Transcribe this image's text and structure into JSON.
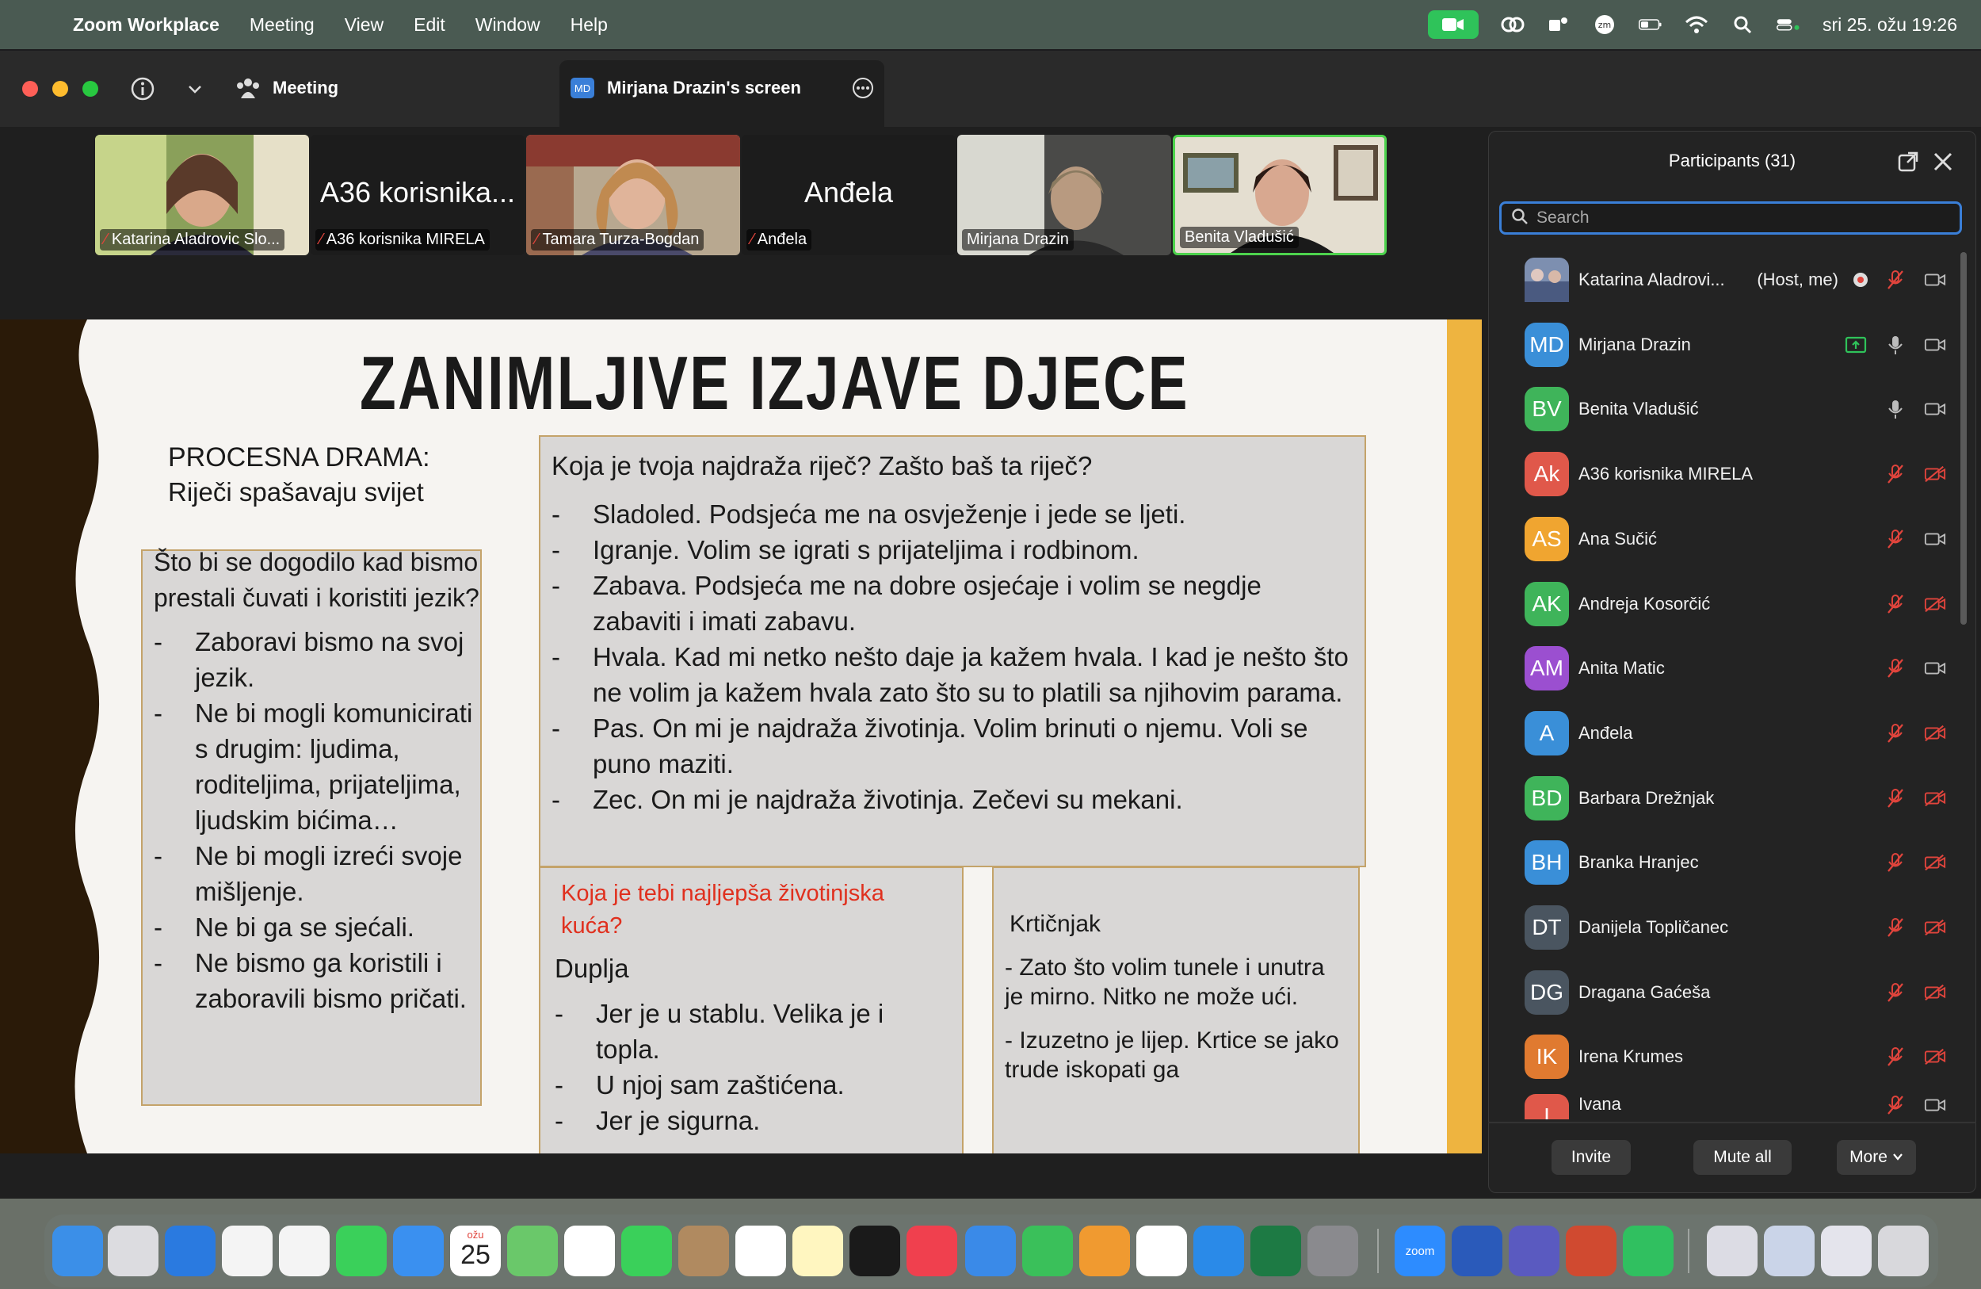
{
  "menubar": {
    "app": "Zoom Workplace",
    "items": [
      "Meeting",
      "View",
      "Edit",
      "Window",
      "Help"
    ],
    "datetime": "sri 25. ožu 19:26"
  },
  "titlebar": {
    "meeting_label": "Meeting",
    "share_badge": "MD",
    "share_tab": "Mirjana Drazin's screen"
  },
  "thumbnails": [
    {
      "name": "Katarina Aladrovic Slo...",
      "muted": true,
      "big": ""
    },
    {
      "name": "A36 korisnika MIRELA",
      "muted": true,
      "big": "A36 korisnika..."
    },
    {
      "name": "Tamara Turza-Bogdan",
      "muted": true,
      "big": ""
    },
    {
      "name": "Anđela",
      "muted": true,
      "big": "Anđela"
    },
    {
      "name": "Mirjana Drazin",
      "muted": false,
      "big": ""
    },
    {
      "name": "Benita Vladušić",
      "muted": false,
      "big": ""
    }
  ],
  "slide": {
    "title": "ZANIMLJIVE IZJAVE DJECE",
    "subtitle1": "PROCESNA DRAMA:",
    "subtitle2": "Riječi spašavaju svijet",
    "left_question": "Što bi se dogodilo kad bismo prestali čuvati i koristiti jezik?",
    "left_items": [
      "Zaboravi bismo na svoj jezik.",
      "Ne bi mogli komunicirati s drugim: ljudima, roditeljima, prijateljima, ljudskim bićima…",
      "Ne bi mogli izreći svoje mišljenje.",
      "Ne bi ga se sjećali.",
      "Ne bismo ga koristili i zaboravili bismo pričati."
    ],
    "main_question": "Koja je tvoja najdraža riječ? Zašto baš ta riječ?",
    "main_items": [
      "Sladoled. Podsjeća me na osvježenje i jede se ljeti.",
      "Igranje. Volim se igrati s prijateljima i rodbinom.",
      "Zabava. Podsjeća me na dobre osjećaje i volim se negdje zabaviti i imati zabavu.",
      "Hvala. Kad mi netko nešto daje ja kažem hvala. I kad je nešto što ne volim ja kažem hvala zato što su to platili sa njihovim parama.",
      "Pas. On mi je najdraža životinja. Volim brinuti o njemu. Voli se puno maziti.",
      "Zec. On mi je najdraža životinja. Zečevi su mekani."
    ],
    "house_question": "Koja je tebi najljepša životinjska kuća?",
    "house_answer": "Duplja",
    "house_items": [
      "Jer je u stablu. Velika je i topla.",
      "U njoj sam zaštićena.",
      "Jer je sigurna."
    ],
    "mole_title": "Krtičnjak",
    "mole_p1": "- Zato što volim tunele i unutra je mirno. Nitko ne može ući.",
    "mole_p2": "- Izuzetno je lijep. Krtice se jako trude iskopati ga"
  },
  "panel": {
    "title": "Participants (31)",
    "search_placeholder": "Search",
    "participants": [
      {
        "initials": "",
        "name": "Katarina Aladrovi...",
        "tag": "(Host, me)",
        "color": "#6b7fa3",
        "mic": "muted",
        "video": "on"
      },
      {
        "initials": "MD",
        "name": "Mirjana Drazin",
        "tag": "",
        "color": "#3a8fd8",
        "mic": "on",
        "video": "on"
      },
      {
        "initials": "BV",
        "name": "Benita Vladušić",
        "tag": "",
        "color": "#3fb45a",
        "mic": "on",
        "video": "on"
      },
      {
        "initials": "Ak",
        "name": "A36 korisnika MIRELA",
        "tag": "",
        "color": "#e0584a",
        "mic": "muted",
        "video": "off"
      },
      {
        "initials": "AS",
        "name": "Ana Sučić",
        "tag": "",
        "color": "#f0a530",
        "mic": "muted",
        "video": "on"
      },
      {
        "initials": "AK",
        "name": "Andreja Kosorčić",
        "tag": "",
        "color": "#3fb45a",
        "mic": "muted",
        "video": "off"
      },
      {
        "initials": "AM",
        "name": "Anita Matic",
        "tag": "",
        "color": "#9b4fd0",
        "mic": "muted",
        "video": "on"
      },
      {
        "initials": "A",
        "name": "Anđela",
        "tag": "",
        "color": "#3a8fd8",
        "mic": "muted",
        "video": "off"
      },
      {
        "initials": "BD",
        "name": "Barbara Drežnjak",
        "tag": "",
        "color": "#3fb45a",
        "mic": "muted",
        "video": "off"
      },
      {
        "initials": "BH",
        "name": "Branka Hranjec",
        "tag": "",
        "color": "#3a8fd8",
        "mic": "muted",
        "video": "off"
      },
      {
        "initials": "DT",
        "name": "Danijela Topličanec",
        "tag": "",
        "color": "#4a5560",
        "mic": "muted",
        "video": "off"
      },
      {
        "initials": "DG",
        "name": "Dragana Gaćeša",
        "tag": "",
        "color": "#4a5560",
        "mic": "muted",
        "video": "off"
      },
      {
        "initials": "IK",
        "name": "Irena Krumes",
        "tag": "",
        "color": "#e07a30",
        "mic": "muted",
        "video": "off"
      },
      {
        "initials": "I",
        "name": "Ivana",
        "tag": "",
        "color": "#e0584a",
        "mic": "muted",
        "video": "on"
      }
    ],
    "invite": "Invite",
    "mute_all": "Mute all",
    "more": "More"
  },
  "dock": {
    "calendar_month": "ožu",
    "calendar_day": "25",
    "zoom_label": "zoom"
  }
}
